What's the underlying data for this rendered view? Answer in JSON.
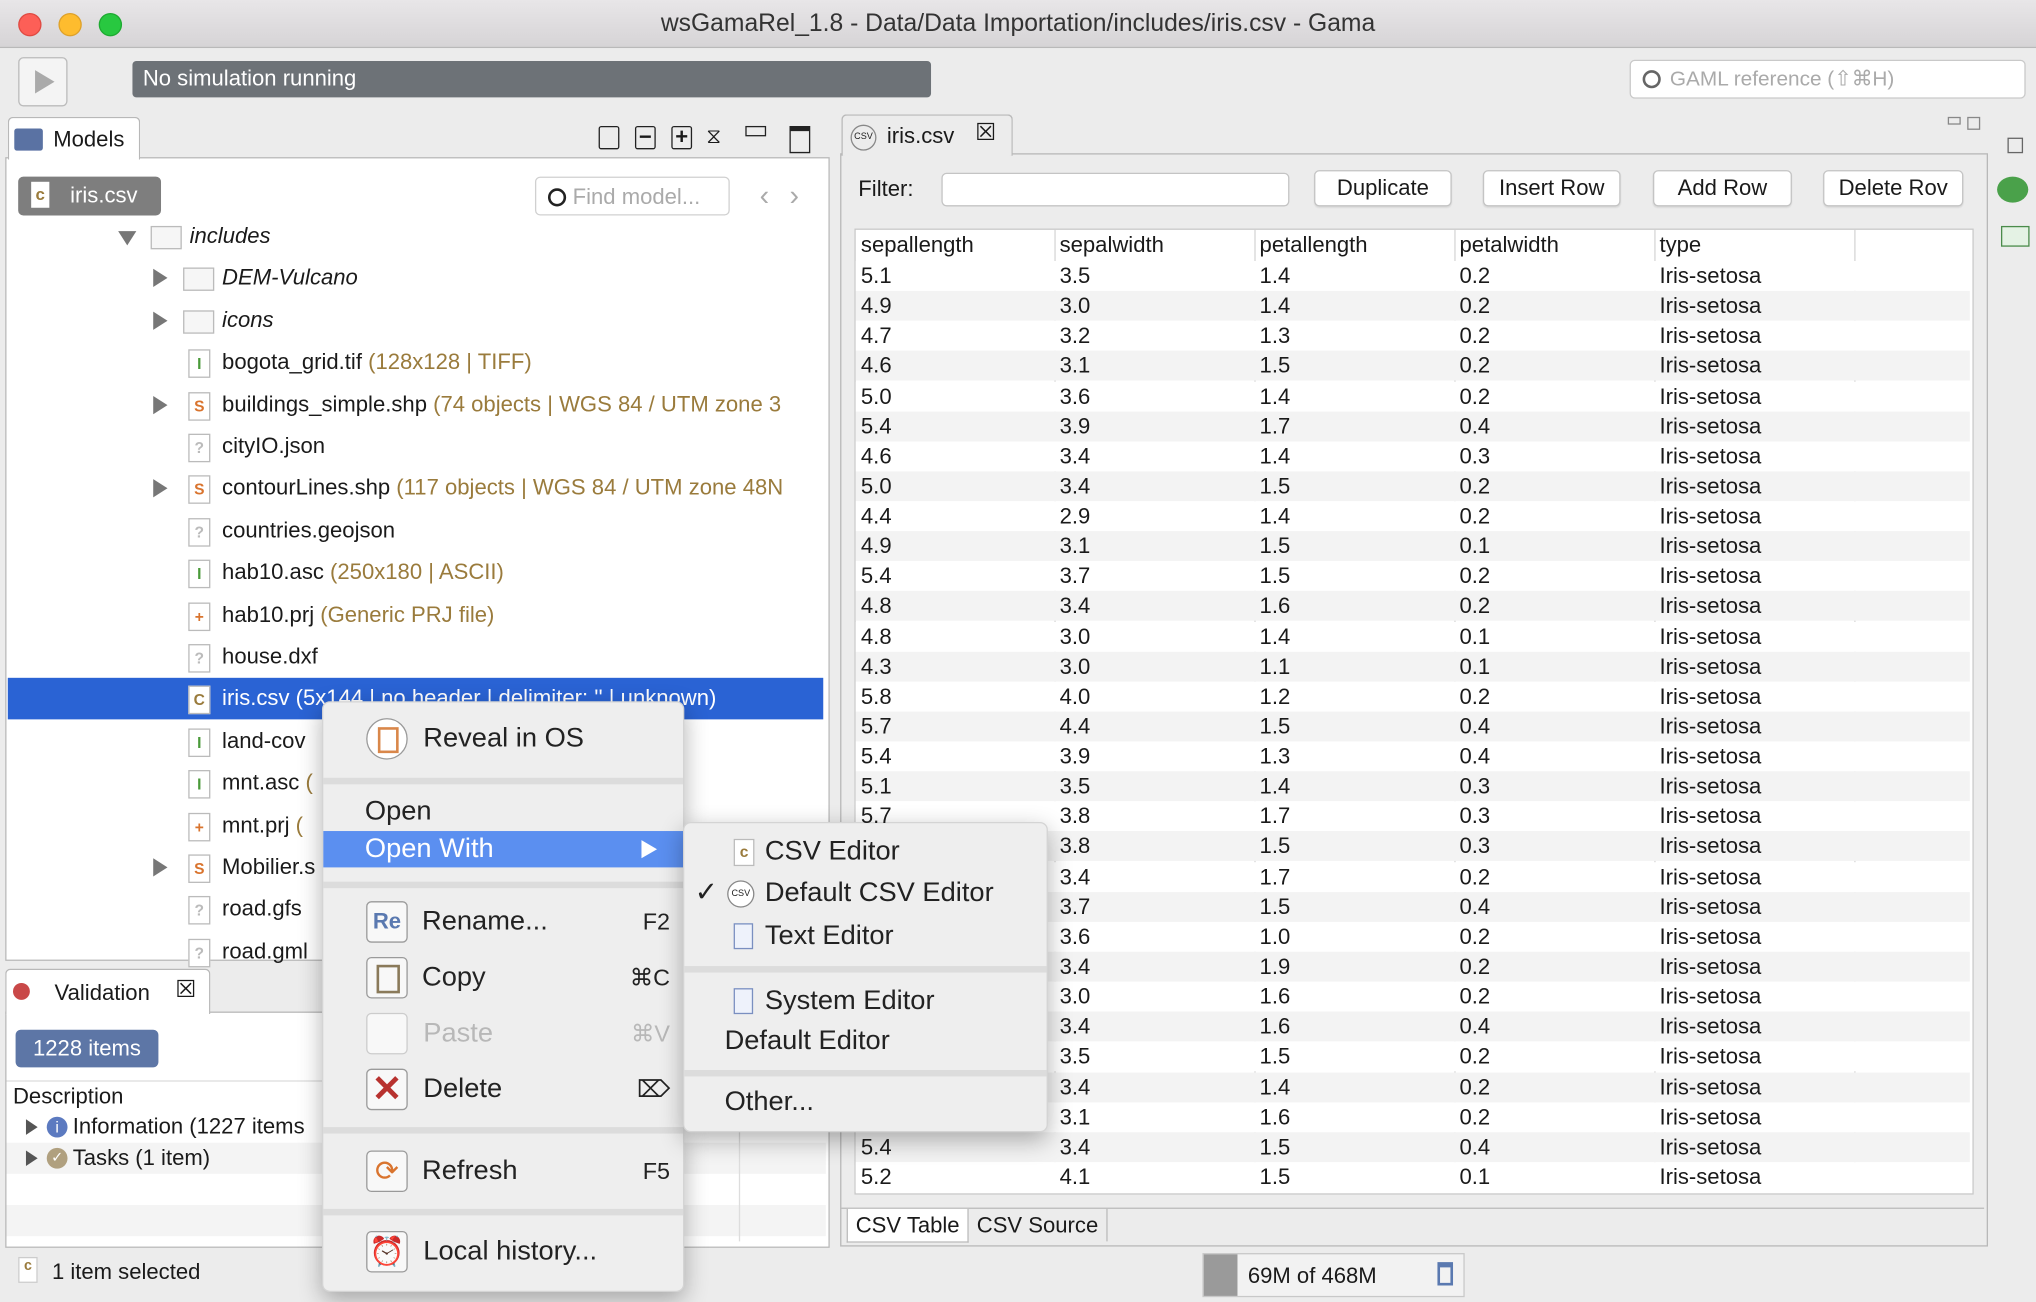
{
  "window": {
    "title": "wsGamaRel_1.8 - Data/Data Importation/includes/iris.csv - Gama"
  },
  "toolbar": {
    "simulation_status": "No simulation running",
    "search_placeholder": "GAML reference (⇧⌘H)"
  },
  "models_panel": {
    "tab_label": "Models",
    "breadcrumb": "iris.csv",
    "find_placeholder": "Find model...",
    "tree": [
      {
        "name": "includes",
        "detail": "",
        "icon": "folder",
        "expanded": true,
        "level": 0,
        "italic": true,
        "arrow": "down"
      },
      {
        "name": "DEM-Vulcano",
        "detail": "",
        "icon": "folder",
        "level": 1,
        "italic": true,
        "arrow": "right"
      },
      {
        "name": "icons",
        "detail": "",
        "icon": "folder",
        "level": 1,
        "italic": true,
        "arrow": "right"
      },
      {
        "name": "bogota_grid.tif",
        "detail": " (128x128 | TIFF)",
        "icon": "grid",
        "level": 1,
        "arrow": ""
      },
      {
        "name": "buildings_simple.shp",
        "detail": " (74 objects | WGS 84 / UTM zone 3",
        "icon": "shape",
        "level": 1,
        "arrow": "right"
      },
      {
        "name": "cityIO.json",
        "detail": "",
        "icon": "unknown",
        "level": 1,
        "arrow": ""
      },
      {
        "name": "contourLines.shp",
        "detail": " (117 objects | WGS 84 / UTM zone 48N",
        "icon": "shape",
        "level": 1,
        "arrow": "right"
      },
      {
        "name": "countries.geojson",
        "detail": "",
        "icon": "unknown",
        "level": 1,
        "arrow": ""
      },
      {
        "name": "hab10.asc",
        "detail": " (250x180 | ASCII)",
        "icon": "grid",
        "level": 1,
        "arrow": ""
      },
      {
        "name": "hab10.prj",
        "detail": " (Generic PRJ file)",
        "icon": "prj",
        "level": 1,
        "arrow": ""
      },
      {
        "name": "house.dxf",
        "detail": "",
        "icon": "unknown",
        "level": 1,
        "arrow": ""
      },
      {
        "name": "iris.csv",
        "detail": " (5x144 | no header | delimiter: '' | unknown)",
        "icon": "csv",
        "level": 1,
        "arrow": "",
        "selected": true
      },
      {
        "name": "land-cov",
        "detail": "",
        "icon": "grid",
        "level": 1,
        "arrow": ""
      },
      {
        "name": "mnt.asc",
        "detail": " (",
        "icon": "grid",
        "level": 1,
        "arrow": ""
      },
      {
        "name": "mnt.prj",
        "detail": " (",
        "icon": "prj",
        "level": 1,
        "arrow": ""
      },
      {
        "name": "Mobilier.s",
        "detail": "",
        "icon": "shape",
        "level": 1,
        "arrow": "right"
      },
      {
        "name": "road.gfs",
        "detail": "",
        "icon": "unknown",
        "level": 1,
        "arrow": ""
      },
      {
        "name": "road.gml",
        "detail": "",
        "icon": "unknown",
        "level": 1,
        "arrow": ""
      }
    ]
  },
  "validation_panel": {
    "tab_label": "Validation",
    "count_badge": "1228 items",
    "column_header": "Description",
    "rows": [
      {
        "label": "Information (1227 items",
        "icon": "info"
      },
      {
        "label": "Tasks (1 item)",
        "icon": "task"
      }
    ]
  },
  "status_bar": {
    "selection": "1 item selected",
    "memory": "69M of 468M"
  },
  "editor": {
    "tab_label": "iris.csv",
    "filter_label": "Filter:",
    "filter_value": "",
    "buttons": [
      "Duplicate",
      "Insert Row",
      "Add Row",
      "Delete Rov"
    ],
    "columns": [
      "sepallength",
      "sepalwidth",
      "petallength",
      "petalwidth",
      "type"
    ],
    "rows": [
      [
        "5.1",
        "3.5",
        "1.4",
        "0.2",
        "Iris-setosa"
      ],
      [
        "4.9",
        "3.0",
        "1.4",
        "0.2",
        "Iris-setosa"
      ],
      [
        "4.7",
        "3.2",
        "1.3",
        "0.2",
        "Iris-setosa"
      ],
      [
        "4.6",
        "3.1",
        "1.5",
        "0.2",
        "Iris-setosa"
      ],
      [
        "5.0",
        "3.6",
        "1.4",
        "0.2",
        "Iris-setosa"
      ],
      [
        "5.4",
        "3.9",
        "1.7",
        "0.4",
        "Iris-setosa"
      ],
      [
        "4.6",
        "3.4",
        "1.4",
        "0.3",
        "Iris-setosa"
      ],
      [
        "5.0",
        "3.4",
        "1.5",
        "0.2",
        "Iris-setosa"
      ],
      [
        "4.4",
        "2.9",
        "1.4",
        "0.2",
        "Iris-setosa"
      ],
      [
        "4.9",
        "3.1",
        "1.5",
        "0.1",
        "Iris-setosa"
      ],
      [
        "5.4",
        "3.7",
        "1.5",
        "0.2",
        "Iris-setosa"
      ],
      [
        "4.8",
        "3.4",
        "1.6",
        "0.2",
        "Iris-setosa"
      ],
      [
        "4.8",
        "3.0",
        "1.4",
        "0.1",
        "Iris-setosa"
      ],
      [
        "4.3",
        "3.0",
        "1.1",
        "0.1",
        "Iris-setosa"
      ],
      [
        "5.8",
        "4.0",
        "1.2",
        "0.2",
        "Iris-setosa"
      ],
      [
        "5.7",
        "4.4",
        "1.5",
        "0.4",
        "Iris-setosa"
      ],
      [
        "5.4",
        "3.9",
        "1.3",
        "0.4",
        "Iris-setosa"
      ],
      [
        "5.1",
        "3.5",
        "1.4",
        "0.3",
        "Iris-setosa"
      ],
      [
        "5.7",
        "3.8",
        "1.7",
        "0.3",
        "Iris-setosa"
      ],
      [
        "",
        "3.8",
        "1.5",
        "0.3",
        "Iris-setosa"
      ],
      [
        "",
        "3.4",
        "1.7",
        "0.2",
        "Iris-setosa"
      ],
      [
        "",
        "3.7",
        "1.5",
        "0.4",
        "Iris-setosa"
      ],
      [
        "",
        "3.6",
        "1.0",
        "0.2",
        "Iris-setosa"
      ],
      [
        "",
        "3.4",
        "1.9",
        "0.2",
        "Iris-setosa"
      ],
      [
        "",
        "3.0",
        "1.6",
        "0.2",
        "Iris-setosa"
      ],
      [
        "",
        "3.4",
        "1.6",
        "0.4",
        "Iris-setosa"
      ],
      [
        "",
        "3.5",
        "1.5",
        "0.2",
        "Iris-setosa"
      ],
      [
        "",
        "3.4",
        "1.4",
        "0.2",
        "Iris-setosa"
      ],
      [
        "",
        "3.1",
        "1.6",
        "0.2",
        "Iris-setosa"
      ],
      [
        "5.4",
        "3.4",
        "1.5",
        "0.4",
        "Iris-setosa"
      ],
      [
        "5.2",
        "4.1",
        "1.5",
        "0.1",
        "Iris-setosa"
      ]
    ],
    "bottom_tabs": [
      "CSV Table",
      "CSV Source"
    ]
  },
  "context_menu": {
    "items": [
      {
        "label": "Reveal in OS",
        "icon": "reveal-icon",
        "shortcut": ""
      },
      {
        "label": "Open",
        "shortcut": ""
      },
      {
        "label": "Open With",
        "highlighted": true,
        "submenu": true
      },
      {
        "label": "Rename...",
        "icon": "rename-icon",
        "shortcut": "F2"
      },
      {
        "label": "Copy",
        "icon": "copy-icon",
        "shortcut": "⌘C"
      },
      {
        "label": "Paste",
        "icon": "paste-icon",
        "shortcut": "⌘V",
        "disabled": true
      },
      {
        "label": "Delete",
        "icon": "delete-icon",
        "shortcut": "⌦"
      },
      {
        "label": "Refresh",
        "icon": "refresh-icon",
        "shortcut": "F5"
      },
      {
        "label": "Local history...",
        "icon": "history-icon",
        "shortcut": ""
      }
    ]
  },
  "submenu": {
    "items": [
      {
        "label": "CSV Editor",
        "icon": "csv-file-icon"
      },
      {
        "label": "Default CSV Editor",
        "icon": "csv-badge-icon",
        "checked": true
      },
      {
        "label": "Text Editor",
        "icon": "text-file-icon"
      },
      {
        "label": "System Editor",
        "icon": "text-file-icon"
      },
      {
        "label": "Default Editor"
      },
      {
        "label": "Other..."
      }
    ]
  },
  "colors": {
    "selection": "#2a63d4",
    "menu_highlight": "#5b8ff0",
    "badge": "#5d76a6",
    "status_field": "#6d7277",
    "detail_text": "#9a7b3c"
  }
}
